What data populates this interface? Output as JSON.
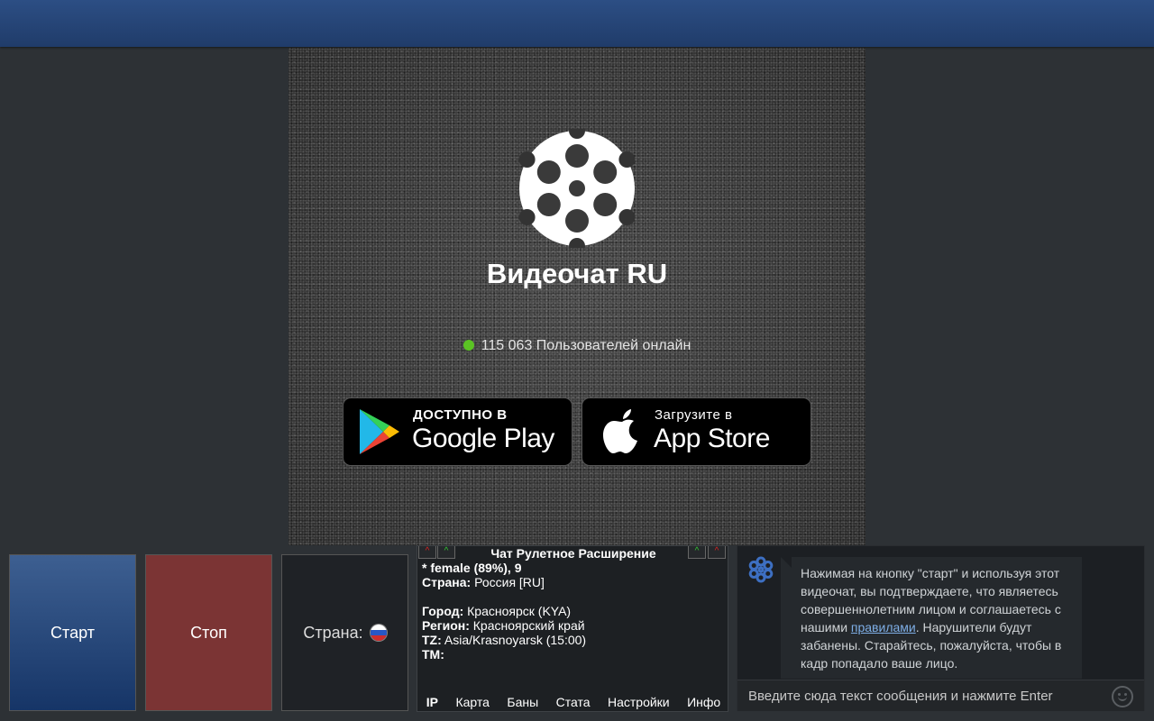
{
  "video": {
    "brand": "Видеочат RU",
    "online_text": "115 063 Пользователей онлайн",
    "online_color": "#5bc324"
  },
  "stores": {
    "google": {
      "small": "ДОСТУПНО В",
      "big": "Google Play"
    },
    "apple": {
      "small": "Загрузите в",
      "big": "App Store"
    }
  },
  "controls": {
    "start_label": "Старт",
    "stop_label": "Стоп",
    "country_label": "Страна:",
    "country_flag": "russia-flag-icon"
  },
  "extension": {
    "title": "Чат Рулетное Расширение",
    "line1": "* female (89%), 9",
    "country_key": "Страна:",
    "country_val": " Россия [RU]",
    "city_key": "Город:",
    "city_val": " Красноярск (KYA)",
    "region_key": "Регион:",
    "region_val": " Красноярский край",
    "tz_key": "TZ:",
    "tz_val": " Asia/Krasnoyarsk (15:00)",
    "tm_key": "TM:",
    "tabs": [
      "IP",
      "Карта",
      "Баны",
      "Стата",
      "Настройки",
      "Инфо"
    ]
  },
  "chat": {
    "msg_before": "Нажимая на кнопку \"старт\" и используя этот видеочат, вы подтверждаете, что являетесь совершеннолетним лицом и соглашаетесь с нашими ",
    "msg_link": "правилами",
    "msg_after": ". Нарушители будут забанены. Старайтесь, пожалуйста, чтобы в кадр попадало ваше лицо.",
    "input_placeholder": "Введите сюда текст сообщения и нажмите Enter"
  },
  "colors": {
    "topbar": "#24447a",
    "start": "#2a4a7c",
    "stop": "#7b3434",
    "link": "#7eaee6"
  }
}
